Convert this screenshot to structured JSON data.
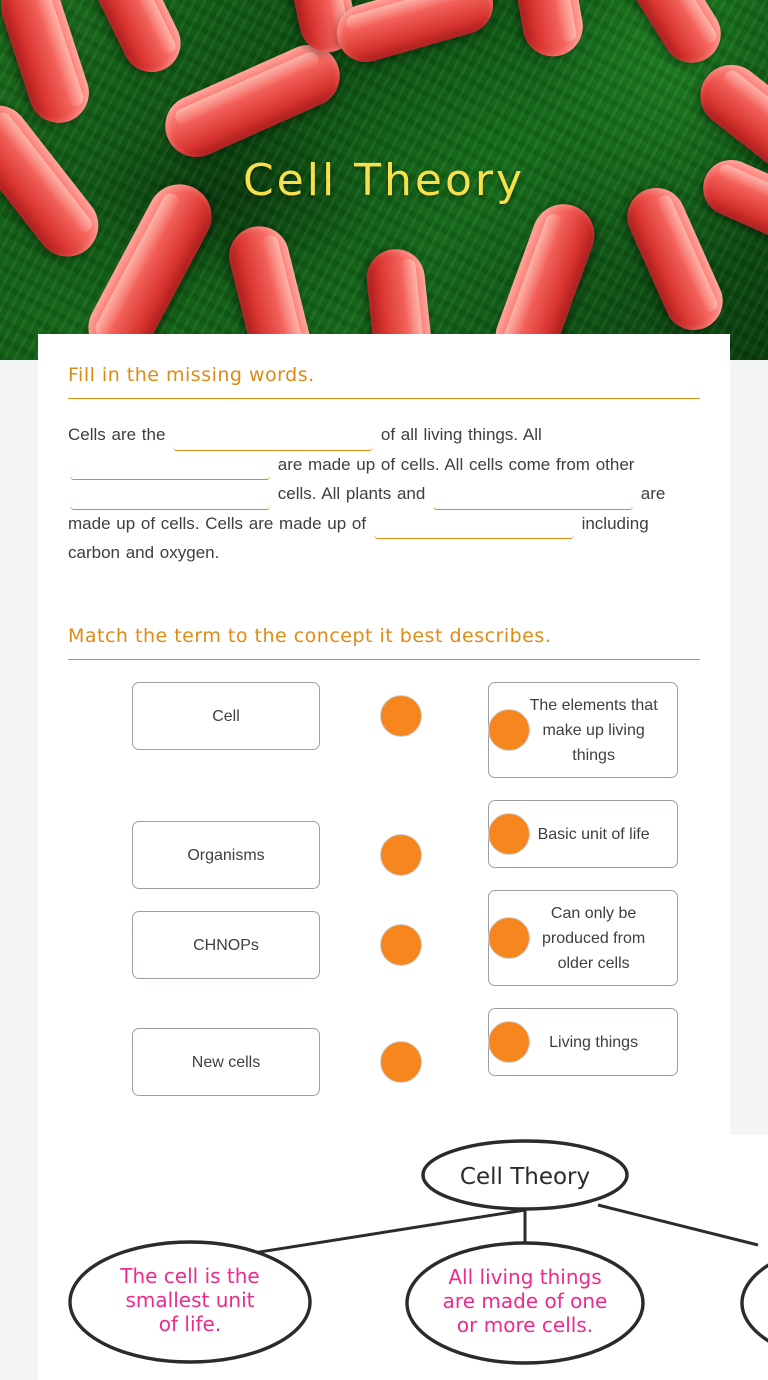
{
  "hero": {
    "title": "Cell Theory",
    "image_alt": "red rod-shaped bacteria on green background",
    "title_color": "#f7e04b"
  },
  "colors": {
    "accent_orange": "#e08a15",
    "dot_orange": "#F7861F",
    "text": "#3c4043",
    "page_bg": "#f4f5f7",
    "pink": "#ee2a8c"
  },
  "fill_section": {
    "heading": "Fill in the missing words.",
    "parts": {
      "p1": "Cells are the",
      "p2": "of all living things. All",
      "p3": "are made up of cells. All cells come from other",
      "p4": "cells. All plants and",
      "p5": "are",
      "p6": "made up of cells. Cells are made up of",
      "p7": "including",
      "p8": "carbon and oxygen."
    },
    "blanks": [
      {
        "value": "",
        "placeholder": ""
      },
      {
        "value": "",
        "placeholder": ""
      },
      {
        "value": "",
        "placeholder": ""
      },
      {
        "value": "",
        "placeholder": ""
      }
    ]
  },
  "match_section": {
    "heading": "Match the term to the concept it best describes.",
    "left_items": [
      {
        "label": "Cell"
      },
      {
        "label": "Organisms"
      },
      {
        "label": "CHNOPs"
      },
      {
        "label": "New cells"
      }
    ],
    "right_items": [
      {
        "label": "The elements that make up living things"
      },
      {
        "label": "Basic unit of life"
      },
      {
        "label": "Can only be produced from older cells"
      },
      {
        "label": "Living things"
      }
    ]
  },
  "diagram": {
    "root": "Cell Theory",
    "bubbles": [
      {
        "label": "The cell is the smallest unit of life."
      },
      {
        "label": "All living things are made of one or more cells."
      },
      {
        "label": ""
      }
    ]
  }
}
